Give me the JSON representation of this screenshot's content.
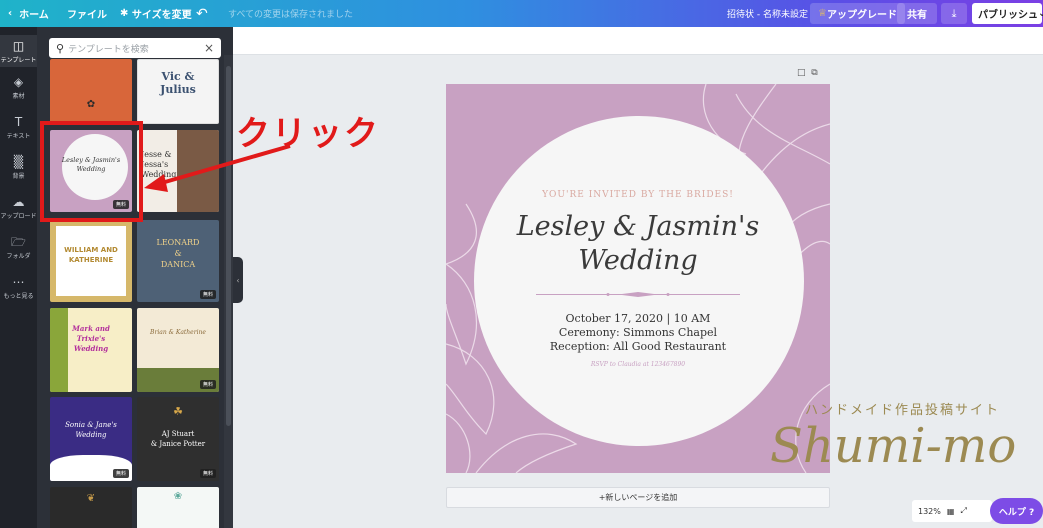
{
  "topbar": {
    "home": "ホーム",
    "file": "ファイル",
    "resize": "サイズを変更",
    "saved_status": "すべての変更は保存されました",
    "doc_title": "招待状 - 名称未設定",
    "upgrade": "アップグレード",
    "share": "共有",
    "publish": "パブリッシュ"
  },
  "leftnav": [
    {
      "label": "テンプレート",
      "icon": "template-icon"
    },
    {
      "label": "素材",
      "icon": "elements-icon"
    },
    {
      "label": "テキスト",
      "icon": "text-icon"
    },
    {
      "label": "背景",
      "icon": "background-icon"
    },
    {
      "label": "アップロード",
      "icon": "upload-icon"
    },
    {
      "label": "フォルダ",
      "icon": "folder-icon"
    },
    {
      "label": "もっと見る",
      "icon": "more-icon"
    }
  ],
  "search": {
    "placeholder": "テンプレートを検索"
  },
  "templates": {
    "free_badge": "無料",
    "t2_line1": "Vic &",
    "t2_line2": "Julius",
    "t3_line1": "Lesley & Jasmin's",
    "t3_line2": "Wedding",
    "t4_line1": "Jesse &",
    "t4_line2": "Jessa's",
    "t4_line3": "Wedding",
    "t5_line1": "WILLIAM AND",
    "t5_line2": "KATHERINE",
    "t6_line1": "LEONARD",
    "t6_line2": "&",
    "t6_line3": "DANICA",
    "t7_line1": "Mark and",
    "t7_line2": "Trixie's",
    "t7_line3": "Wedding",
    "t8_line1": "Brian & Katherine",
    "t9_line1": "Sonia & Jane's",
    "t9_line2": "Wedding",
    "t10_line1": "AJ Stuart",
    "t10_line2": "& Janice Potter"
  },
  "invite": {
    "subtitle": "YOU'RE INVITED BY THE BRIDES!",
    "title_line1": "Lesley & Jasmin's",
    "title_line2": "Wedding",
    "date": "October 17, 2020 | 10 AM",
    "ceremony": "Ceremony: Simmons Chapel",
    "reception": "Reception: All Good Restaurant",
    "rsvp": "RSVP to Claudia at 123467890"
  },
  "canvas": {
    "add_page": "+新しいページを追加",
    "zoom": "132%",
    "help": "ヘルプ ?"
  },
  "annotation": {
    "click_label": "クリック"
  },
  "watermark": {
    "sub": "ハンドメイド作品投稿サイト",
    "main": "Shumi-mo"
  },
  "colors": {
    "accent": "#7d4ce6",
    "card_pink": "#c8a1c2",
    "annotation_red": "#e11a1a"
  }
}
